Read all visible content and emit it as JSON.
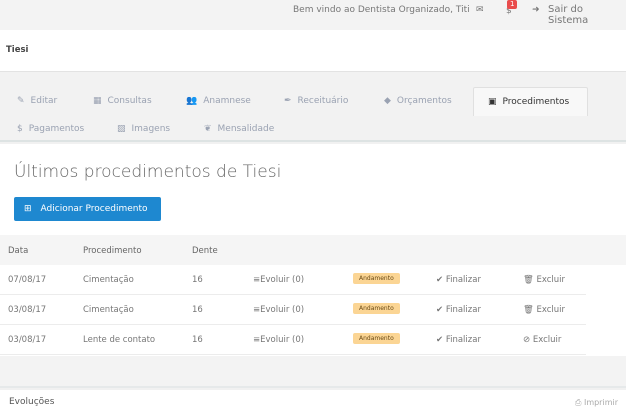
{
  "topbar": {
    "welcome": "Bem vindo ao Dentista Organizado, Titi",
    "mail_icon": "envelope-icon",
    "dollar_icon": "$",
    "badge": "1",
    "logout": "Sair do Sistema"
  },
  "patient": {
    "name": "Tiesi"
  },
  "tabs": [
    {
      "label": "Editar",
      "icon": "✎"
    },
    {
      "label": "Consultas",
      "icon": "▦"
    },
    {
      "label": "Anamnese",
      "icon": "👥"
    },
    {
      "label": "Receituário",
      "icon": "✒"
    },
    {
      "label": "Orçamentos",
      "icon": "◆"
    },
    {
      "label": "Procedimentos",
      "icon": "▣"
    },
    {
      "label": "Pagamentos",
      "icon": "$"
    },
    {
      "label": "Imagens",
      "icon": "▨"
    },
    {
      "label": "Mensalidade",
      "icon": "❦"
    }
  ],
  "main": {
    "title": "Últimos procedimentos de Tiesi",
    "add_button": "Adicionar Procedimento"
  },
  "table": {
    "headers": [
      "Data",
      "Procedimento",
      "Dente"
    ],
    "rows": [
      {
        "date": "07/08/17",
        "proc": "Cimentação",
        "tooth": "16",
        "evolve": "Evoluir (0)",
        "status": "Andamento",
        "finish": "Finalizar",
        "delete": "Excluir",
        "delete_icon": "🗑"
      },
      {
        "date": "03/08/17",
        "proc": "Cimentação",
        "tooth": "16",
        "evolve": "Evoluir (0)",
        "status": "Andamento",
        "finish": "Finalizar",
        "delete": "Excluir",
        "delete_icon": "🗑"
      },
      {
        "date": "03/08/17",
        "proc": "Lente de contato",
        "tooth": "16",
        "evolve": "Evoluir (0)",
        "status": "Andamento",
        "finish": "Finalizar",
        "delete": "Excluir",
        "delete_icon": "⊘"
      }
    ]
  },
  "evolucoes": {
    "title": "Evoluções",
    "print": "Imprimir"
  },
  "colors": {
    "primary": "#1e88d0",
    "status": "#fbd594",
    "badge": "#e94c4c"
  }
}
